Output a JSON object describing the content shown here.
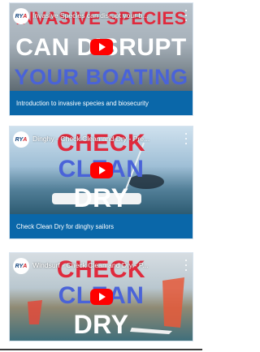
{
  "videos": [
    {
      "title": "Invasive Species can disrupt your b...",
      "overlay": [
        "INVASIVE SPECIES",
        "CAN DISRUPT",
        "YOUR BOATING"
      ],
      "caption": "Introduction to invasive species and biosecurity"
    },
    {
      "title": "Dinghy - Check Clean and Dry - Pre...",
      "overlay": [
        "CHECK",
        "CLEAN",
        "DRY"
      ],
      "caption": "Check Clean Dry for dinghy sailors"
    },
    {
      "title": "Windsurf - Check Clean and Dry - P...",
      "overlay": [
        "CHECK",
        "CLEAN",
        "DRY"
      ],
      "caption": ""
    }
  ],
  "logo_text": "RYA",
  "colors": {
    "card_blue": "#0a67a9",
    "play_red": "#ff0000",
    "text_red": "#e02a3d",
    "text_blue": "#4a63d8"
  },
  "icons": [
    "rya-logo",
    "play-icon",
    "more-vert-icon"
  ]
}
